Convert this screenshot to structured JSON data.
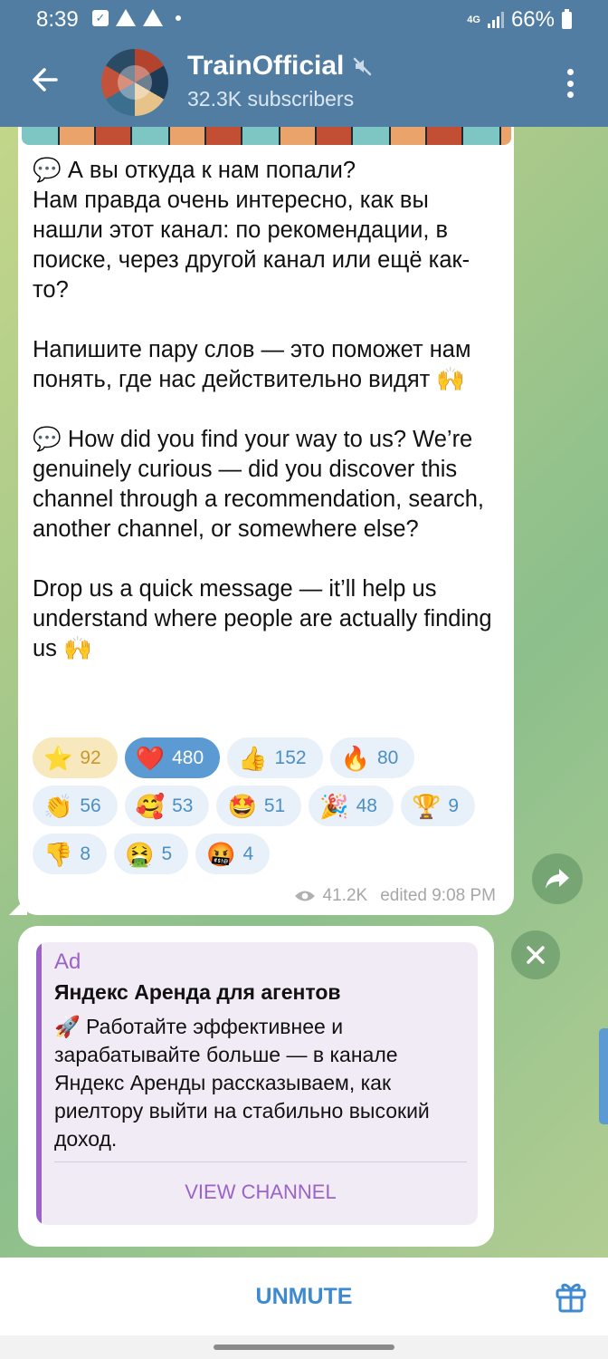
{
  "status_bar": {
    "time": "8:39",
    "network": "4G",
    "battery": "66%"
  },
  "header": {
    "back_icon": "arrow-left-icon",
    "channel_name": "TrainOfficial",
    "subscribers": "32.3K subscribers",
    "muted_icon": "muted-speaker-icon",
    "menu_icon": "more-vertical-icon"
  },
  "message": {
    "text": "💬 А вы откуда к нам попали?\nНам правда очень интересно, как вы нашли этот канал: по рекомендации, в поиске, через другой канал или ещё как-то?\n\nНапишите пару слов — это поможет нам понять, где нас действительно видят 🙌\n\n💬 How did you find your way to us? We’re genuinely curious — did you discover this channel through a recommendation, search, another channel, or somewhere else?\n\nDrop us a quick message — it’ll help us understand where people are actually finding us 🙌",
    "reactions": [
      [
        {
          "emoji": "⭐",
          "count": "92",
          "style": "gold"
        },
        {
          "emoji": "❤️",
          "count": "480",
          "style": "active"
        },
        {
          "emoji": "👍",
          "count": "152",
          "style": "normal"
        },
        {
          "emoji": "🔥",
          "count": "80",
          "style": "normal"
        }
      ],
      [
        {
          "emoji": "👏",
          "count": "56",
          "style": "normal"
        },
        {
          "emoji": "🥰",
          "count": "53",
          "style": "normal"
        },
        {
          "emoji": "🤩",
          "count": "51",
          "style": "normal"
        },
        {
          "emoji": "🎉",
          "count": "48",
          "style": "normal"
        },
        {
          "emoji": "🏆",
          "count": "9",
          "style": "normal"
        }
      ],
      [
        {
          "emoji": "👎",
          "count": "8",
          "style": "normal"
        },
        {
          "emoji": "🤮",
          "count": "5",
          "style": "normal"
        },
        {
          "emoji": "🤬",
          "count": "4",
          "style": "normal"
        }
      ]
    ],
    "views": "41.2K",
    "edited": "edited 9:08 PM"
  },
  "ad": {
    "label": "Ad",
    "title": "Яндекс Аренда для агентов",
    "text": "🚀 Работайте эффективнее и зарабатывайте больше — в канале Яндекс Аренды рассказываем, как риелтору выйти на стабильно высокий доход.",
    "button": "VIEW CHANNEL"
  },
  "bottom": {
    "unmute": "UNMUTE",
    "gift_icon": "gift-icon"
  },
  "colors": {
    "header": "#527da3",
    "accent": "#3e8ad0",
    "ad_accent": "#9b63c7"
  }
}
